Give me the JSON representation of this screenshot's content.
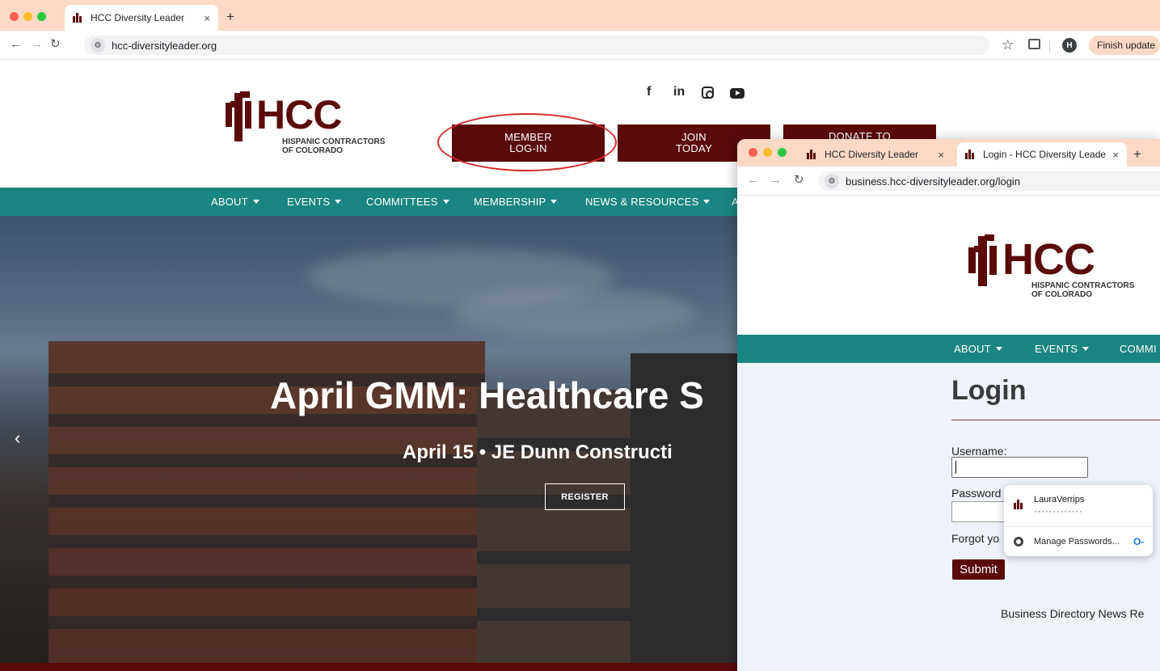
{
  "back_window": {
    "tab_title": "HCC Diversity Leader",
    "tab_close": "×",
    "new_tab": "+",
    "url": "hcc-diversityleader.org",
    "profile_initial": "H",
    "finish_update": "Finish update",
    "more": "⋮",
    "logo": {
      "word": "HCC",
      "sub_line1": "HISPANIC CONTRACTORS",
      "sub_line2": "OF COLORADO"
    },
    "social": {
      "facebook": "f",
      "linkedin": "in"
    },
    "cta": {
      "member_l1": "MEMBER",
      "member_l2": "LOG-IN",
      "join_l1": "JOIN",
      "join_l2": "TODAY",
      "donate_l1": "DONATE TO"
    },
    "nav": [
      "ABOUT",
      "EVENTS",
      "COMMITTEES",
      "MEMBERSHIP",
      "NEWS & RESOURCES",
      "A"
    ],
    "hero": {
      "title": "April GMM: Healthcare S",
      "subtitle": "April 15 • JE Dunn Constructi",
      "button": "REGISTER",
      "prev": "‹"
    }
  },
  "front_window": {
    "tab1_title": "HCC Diversity Leader",
    "tab2_title": "Login - HCC Diversity Leader",
    "tab_close": "×",
    "new_tab": "+",
    "url": "business.hcc-diversityleader.org/login",
    "logo": {
      "word": "HCC",
      "sub_line1": "HISPANIC CONTRACTORS",
      "sub_line2": "OF COLORADO"
    },
    "nav": [
      "ABOUT",
      "EVENTS",
      "COMMI"
    ],
    "login": {
      "title": "Login",
      "username_label": "Username:",
      "username_value": "",
      "password_label": "Password",
      "forgot": "Forgot yo",
      "submit": "Submit"
    },
    "password_popup": {
      "username": "LauraVerrips",
      "masked": "·············",
      "manage": "Manage Passwords..."
    },
    "footer_links": "Business Directory  News Re"
  },
  "colors": {
    "brand_maroon": "#5b0a0a",
    "nav_teal": "#1b8583",
    "tabbar_peach": "#fbd9c4",
    "annotation_red": "#d12a2a"
  },
  "icons": [
    "hcc-logo-icon",
    "star-icon",
    "lens-icon",
    "facebook-icon",
    "linkedin-icon",
    "instagram-icon",
    "youtube-icon",
    "chrome-icon",
    "key-icon"
  ]
}
